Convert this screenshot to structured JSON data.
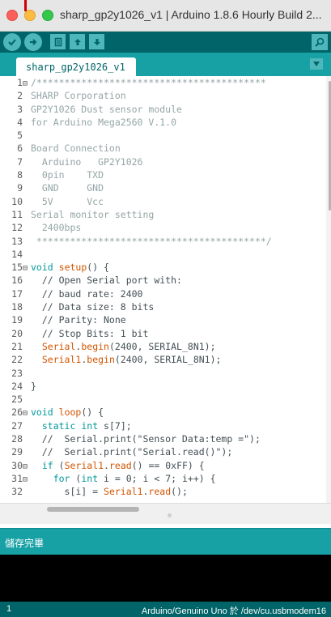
{
  "window": {
    "title": "sharp_gp2y1026_v1 | Arduino 1.8.6 Hourly Build 2..."
  },
  "toolbar": {
    "buttons": [
      "verify-icon",
      "upload-icon",
      "new-icon",
      "open-icon",
      "save-icon"
    ],
    "serial_monitor": "serial-monitor-icon"
  },
  "tabs": {
    "active": "sharp_gp2y1026_v1",
    "menu": "tab-menu-icon"
  },
  "editor": {
    "lines": [
      {
        "n": "1",
        "fold": "⊟",
        "tokens": [
          {
            "t": "cm",
            "v": "/*****************************************"
          }
        ]
      },
      {
        "n": "2",
        "fold": "",
        "tokens": [
          {
            "t": "cm",
            "v": "SHARP Corporation"
          }
        ]
      },
      {
        "n": "3",
        "fold": "",
        "tokens": [
          {
            "t": "cm",
            "v": "GP2Y1026 Dust sensor module"
          }
        ]
      },
      {
        "n": "4",
        "fold": "",
        "tokens": [
          {
            "t": "cm",
            "v": "for Arduino Mega2560 V.1.0"
          }
        ]
      },
      {
        "n": "5",
        "fold": "",
        "tokens": []
      },
      {
        "n": "6",
        "fold": "",
        "tokens": [
          {
            "t": "cm",
            "v": "Board Connection"
          }
        ]
      },
      {
        "n": "7",
        "fold": "",
        "tokens": [
          {
            "t": "cm",
            "v": "  Arduino   GP2Y1026"
          }
        ]
      },
      {
        "n": "8",
        "fold": "",
        "tokens": [
          {
            "t": "cm",
            "v": "  0pin    TXD"
          }
        ]
      },
      {
        "n": "9",
        "fold": "",
        "tokens": [
          {
            "t": "cm",
            "v": "  GND     GND"
          }
        ]
      },
      {
        "n": "10",
        "fold": "",
        "tokens": [
          {
            "t": "cm",
            "v": "  5V      Vcc"
          }
        ]
      },
      {
        "n": "11",
        "fold": "",
        "tokens": [
          {
            "t": "cm",
            "v": "Serial monitor setting"
          }
        ]
      },
      {
        "n": "12",
        "fold": "",
        "tokens": [
          {
            "t": "cm",
            "v": "  2400bps"
          }
        ]
      },
      {
        "n": "13",
        "fold": "",
        "tokens": [
          {
            "t": "cm",
            "v": " *****************************************/"
          }
        ]
      },
      {
        "n": "14",
        "fold": "",
        "tokens": []
      },
      {
        "n": "15",
        "fold": "⊟",
        "tokens": [
          {
            "t": "kw",
            "v": "void"
          },
          {
            "t": "pl",
            "v": " "
          },
          {
            "t": "fn",
            "v": "setup"
          },
          {
            "t": "pl",
            "v": "() {"
          }
        ]
      },
      {
        "n": "16",
        "fold": "",
        "tokens": [
          {
            "t": "pl",
            "v": "  // Open Serial port with:"
          }
        ]
      },
      {
        "n": "17",
        "fold": "",
        "tokens": [
          {
            "t": "pl",
            "v": "  // baud rate: 2400"
          }
        ]
      },
      {
        "n": "18",
        "fold": "",
        "tokens": [
          {
            "t": "pl",
            "v": "  // Data size: 8 bits"
          }
        ]
      },
      {
        "n": "19",
        "fold": "",
        "tokens": [
          {
            "t": "pl",
            "v": "  // Parity: None"
          }
        ]
      },
      {
        "n": "20",
        "fold": "",
        "tokens": [
          {
            "t": "pl",
            "v": "  // Stop Bits: 1 bit"
          }
        ]
      },
      {
        "n": "21",
        "fold": "",
        "tokens": [
          {
            "t": "pl",
            "v": "  "
          },
          {
            "t": "fn",
            "v": "Serial"
          },
          {
            "t": "pl",
            "v": "."
          },
          {
            "t": "fn",
            "v": "begin"
          },
          {
            "t": "pl",
            "v": "(2400, SERIAL_8N1);"
          }
        ]
      },
      {
        "n": "22",
        "fold": "",
        "tokens": [
          {
            "t": "pl",
            "v": "  "
          },
          {
            "t": "fn",
            "v": "Serial1"
          },
          {
            "t": "pl",
            "v": "."
          },
          {
            "t": "fn",
            "v": "begin"
          },
          {
            "t": "pl",
            "v": "(2400, SERIAL_8N1);"
          }
        ]
      },
      {
        "n": "23",
        "fold": "",
        "tokens": []
      },
      {
        "n": "24",
        "fold": "",
        "tokens": [
          {
            "t": "pl",
            "v": "}"
          }
        ]
      },
      {
        "n": "25",
        "fold": "",
        "tokens": []
      },
      {
        "n": "26",
        "fold": "⊟",
        "tokens": [
          {
            "t": "kw",
            "v": "void"
          },
          {
            "t": "pl",
            "v": " "
          },
          {
            "t": "fn",
            "v": "loop"
          },
          {
            "t": "pl",
            "v": "() {"
          }
        ]
      },
      {
        "n": "27",
        "fold": "",
        "tokens": [
          {
            "t": "pl",
            "v": "  "
          },
          {
            "t": "kw",
            "v": "static"
          },
          {
            "t": "pl",
            "v": " "
          },
          {
            "t": "kw",
            "v": "int"
          },
          {
            "t": "pl",
            "v": " s[7];"
          }
        ]
      },
      {
        "n": "28",
        "fold": "",
        "tokens": [
          {
            "t": "pl",
            "v": "  //  Serial.print(\"Sensor Data:temp =\");"
          }
        ]
      },
      {
        "n": "29",
        "fold": "",
        "tokens": [
          {
            "t": "pl",
            "v": "  //  Serial.print(\"Serial.read()\");"
          }
        ]
      },
      {
        "n": "30",
        "fold": "⊟",
        "tokens": [
          {
            "t": "pl",
            "v": "  "
          },
          {
            "t": "kw",
            "v": "if"
          },
          {
            "t": "pl",
            "v": " ("
          },
          {
            "t": "fn",
            "v": "Serial1"
          },
          {
            "t": "pl",
            "v": "."
          },
          {
            "t": "fn",
            "v": "read"
          },
          {
            "t": "pl",
            "v": "() == 0xFF) {"
          }
        ]
      },
      {
        "n": "31",
        "fold": "⊟",
        "tokens": [
          {
            "t": "pl",
            "v": "    "
          },
          {
            "t": "kw",
            "v": "for"
          },
          {
            "t": "pl",
            "v": " ("
          },
          {
            "t": "kw",
            "v": "int"
          },
          {
            "t": "pl",
            "v": " i = 0; i < 7; i++) {"
          }
        ]
      },
      {
        "n": "32",
        "fold": "",
        "tokens": [
          {
            "t": "pl",
            "v": "      s[i] = "
          },
          {
            "t": "fn",
            "v": "Serial1"
          },
          {
            "t": "pl",
            "v": "."
          },
          {
            "t": "fn",
            "v": "read"
          },
          {
            "t": "pl",
            "v": "();"
          }
        ]
      }
    ]
  },
  "status": {
    "message": "儲存完畢"
  },
  "footer": {
    "line": "1",
    "board": "Arduino/Genuino Uno 於 /dev/cu.usbmodem16"
  },
  "colors": {
    "toolbar_bg": "#006468",
    "tabbar_bg": "#17a1a5",
    "comment": "#95a5a6",
    "keyword": "#00979c",
    "function": "#d35400"
  }
}
